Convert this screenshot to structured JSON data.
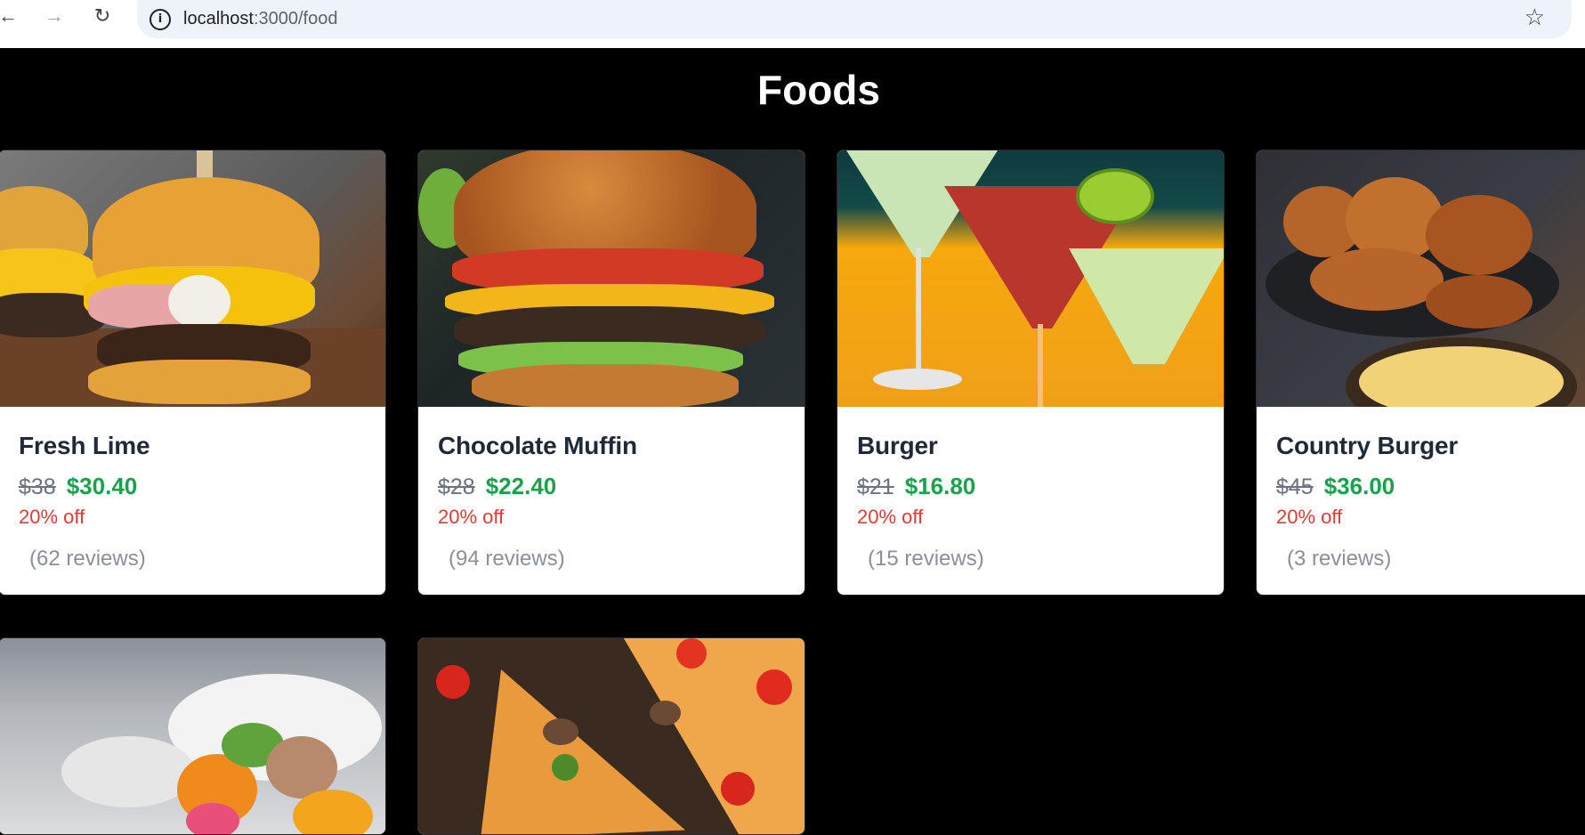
{
  "browser": {
    "url_host": "localhost",
    "url_path": ":3000/food"
  },
  "page": {
    "title": "Foods"
  },
  "foods": [
    {
      "name": "Fresh Lime",
      "old_price": "$38",
      "new_price": "$30.40",
      "discount": "20% off",
      "reviews": "(62 reviews)"
    },
    {
      "name": "Chocolate Muffin",
      "old_price": "$28",
      "new_price": "$22.40",
      "discount": "20% off",
      "reviews": "(94 reviews)"
    },
    {
      "name": "Burger",
      "old_price": "$21",
      "new_price": "$16.80",
      "discount": "20% off",
      "reviews": "(15 reviews)"
    },
    {
      "name": "Country Burger",
      "old_price": "$45",
      "new_price": "$36.00",
      "discount": "20% off",
      "reviews": "(3 reviews)"
    }
  ],
  "colors": {
    "background": "#000000",
    "price_green": "#16a34a",
    "discount_red": "#e53935"
  }
}
